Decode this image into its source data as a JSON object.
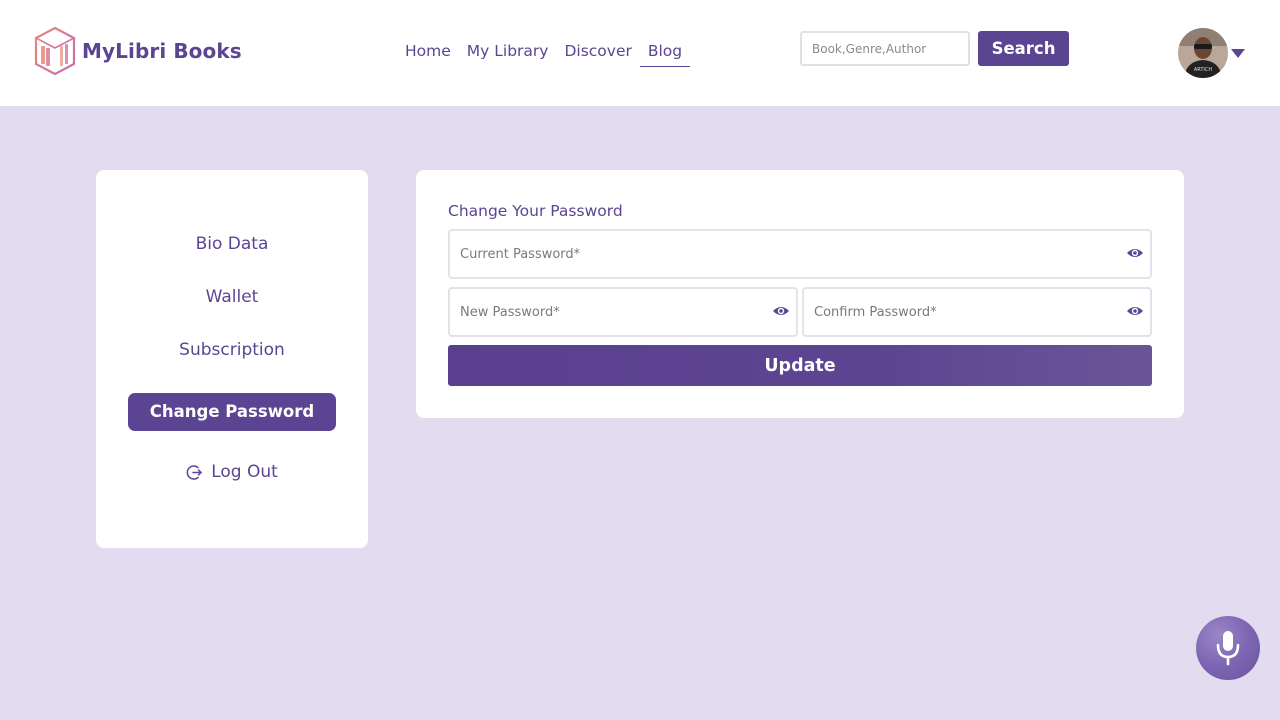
{
  "brand": {
    "name": "MyLibri Books"
  },
  "nav": {
    "items": [
      {
        "label": "Home"
      },
      {
        "label": "My Library"
      },
      {
        "label": "Discover"
      },
      {
        "label": "Blog"
      }
    ],
    "active": "Blog"
  },
  "search": {
    "placeholder": "Book,Genre,Author",
    "button_label": "Search"
  },
  "user": {
    "avatar": "user-avatar",
    "menu_icon": "caret-down-icon"
  },
  "sidebar": {
    "items": [
      {
        "label": "Bio Data"
      },
      {
        "label": "Wallet"
      },
      {
        "label": "Subscription"
      },
      {
        "label": "Change Password"
      },
      {
        "label": "Log Out",
        "icon": "logout-icon"
      }
    ],
    "active": "Change Password"
  },
  "form": {
    "title": "Change Your Password",
    "current_password": {
      "placeholder": "Current Password*",
      "value": ""
    },
    "new_password": {
      "placeholder": "New Password*",
      "value": ""
    },
    "confirm_password": {
      "placeholder": "Confirm Password*",
      "value": ""
    },
    "submit_label": "Update",
    "toggle_icon": "eye-icon"
  },
  "voice_button": {
    "icon": "microphone-icon"
  },
  "colors": {
    "brand": "#5b4593",
    "background": "#e3dbef",
    "card": "#ffffff"
  }
}
